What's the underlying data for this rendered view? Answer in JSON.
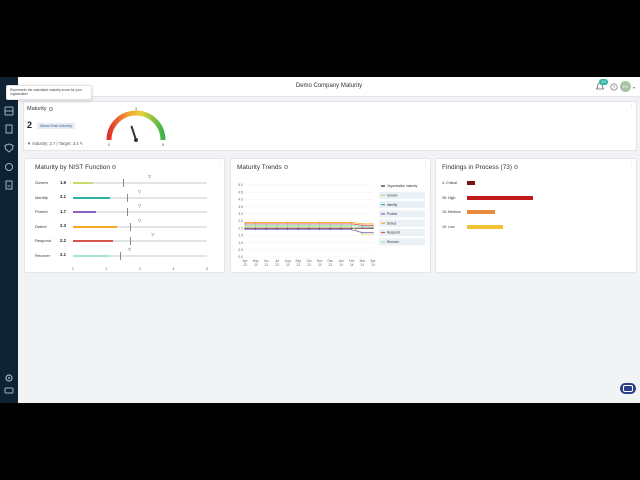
{
  "header": {
    "title": "Demo Company Maturity",
    "notifications_count": "33",
    "avatar_initials": "RJ"
  },
  "tooltip": {
    "text": "Represents the calculated maturity score for your organization"
  },
  "maturity": {
    "title": "Maturity",
    "value": "2",
    "badge": "Worse than industry",
    "industry_label": "Industry: 2.7",
    "separator": "|",
    "target_label": "Target: 3.4",
    "gauge": {
      "min": "0",
      "max": "5",
      "mid": "3",
      "value_fraction": 0.4
    }
  },
  "nist": {
    "title": "Maturity by NIST Function",
    "axis_ticks": [
      "1",
      "2",
      "3",
      "4",
      "5"
    ],
    "rows": [
      {
        "label": "Govern",
        "value": "1.6",
        "score": 1.6,
        "target": 3.3,
        "industry": 2.5,
        "color": "#c8dc6b"
      },
      {
        "label": "Identify",
        "value": "2.1",
        "score": 2.1,
        "target": 3.0,
        "industry": 2.6,
        "color": "#2bb3a3"
      },
      {
        "label": "Protect",
        "value": "1.7",
        "score": 1.7,
        "target": 3.0,
        "industry": 2.6,
        "color": "#8a63c8"
      },
      {
        "label": "Detect",
        "value": "2.3",
        "score": 2.3,
        "target": 3.0,
        "industry": 2.7,
        "color": "#f4a824"
      },
      {
        "label": "Respond",
        "value": "2.2",
        "score": 2.2,
        "target": 3.4,
        "industry": 2.7,
        "color": "#d9534f"
      },
      {
        "label": "Recover",
        "value": "2.1",
        "score": 2.1,
        "target": 2.7,
        "industry": 2.4,
        "color": "#a8e6c8"
      }
    ]
  },
  "trends": {
    "title": "Maturity Trends",
    "chart_data": {
      "type": "line",
      "x": [
        "Apr 23",
        "May 23",
        "Jun 23",
        "Jul 23",
        "Aug 23",
        "Sep 23",
        "Oct 23",
        "Nov 23",
        "Dec 23",
        "Jan 24",
        "Feb 24",
        "Mar 24",
        "Apr 24"
      ],
      "yticks": [
        "0.0",
        "0.5",
        "1.0",
        "1.5",
        "2.0",
        "2.5",
        "3.0",
        "3.5",
        "4.0",
        "4.5",
        "5.0"
      ],
      "ylim": [
        0,
        5
      ],
      "series": [
        {
          "name": "Organization maturity",
          "color": "#4a1a1a",
          "values": [
            2.0,
            2.0,
            2.0,
            2.0,
            2.0,
            2.0,
            2.0,
            2.0,
            2.0,
            2.0,
            2.0,
            2.0,
            2.0
          ]
        },
        {
          "name": "Govern",
          "color": "#c8dc6b",
          "values": [
            2.1,
            2.1,
            2.1,
            2.1,
            2.1,
            2.1,
            2.1,
            2.1,
            2.1,
            2.1,
            2.1,
            1.6,
            1.6
          ]
        },
        {
          "name": "Identify",
          "color": "#2bb3a3",
          "values": [
            2.2,
            2.2,
            2.2,
            2.2,
            2.2,
            2.2,
            2.2,
            2.2,
            2.2,
            2.2,
            2.2,
            2.1,
            2.1
          ]
        },
        {
          "name": "Protect",
          "color": "#8a63c8",
          "values": [
            1.9,
            1.9,
            1.9,
            1.9,
            1.9,
            1.9,
            1.9,
            1.9,
            1.9,
            1.9,
            1.9,
            1.7,
            1.7
          ]
        },
        {
          "name": "Detect",
          "color": "#f4a824",
          "values": [
            2.4,
            2.4,
            2.4,
            2.4,
            2.4,
            2.4,
            2.4,
            2.4,
            2.4,
            2.4,
            2.4,
            2.3,
            2.3
          ]
        },
        {
          "name": "Respond",
          "color": "#d9534f",
          "values": [
            2.3,
            2.3,
            2.3,
            2.3,
            2.3,
            2.3,
            2.3,
            2.3,
            2.3,
            2.3,
            2.3,
            2.2,
            2.2
          ]
        },
        {
          "name": "Recover",
          "color": "#a8e6c8",
          "values": [
            2.2,
            2.2,
            2.2,
            2.2,
            2.2,
            2.2,
            2.2,
            2.2,
            2.2,
            2.2,
            2.2,
            2.1,
            2.1
          ]
        }
      ],
      "legend_position": "right"
    }
  },
  "findings": {
    "title": "Findings in Process (73)",
    "chart_data": {
      "type": "bar",
      "categories": [
        "4: Critical",
        "35: High",
        "15: Medium",
        "19: Low"
      ],
      "values": [
        4,
        35,
        15,
        19
      ],
      "colors": [
        "#7a1414",
        "#c0191d",
        "#e68a3c",
        "#f1c232"
      ]
    }
  }
}
